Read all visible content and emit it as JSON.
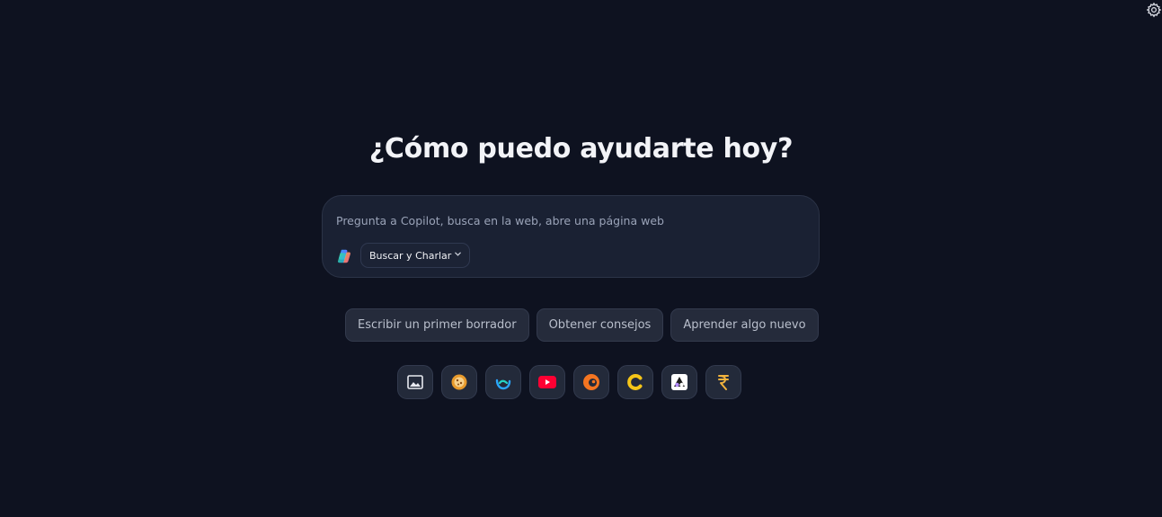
{
  "heading": "¿Cómo puedo ayudarte hoy?",
  "composer": {
    "placeholder": "Pregunta a Copilot, busca en la web, abre una página web",
    "mode_label": "Buscar y Charlar",
    "logo_icon": "copilot-logo-icon",
    "chevron_icon": "chevron-down-icon"
  },
  "suggestions": [
    {
      "label": "Escribir un primer borrador"
    },
    {
      "label": "Obtener consejos"
    },
    {
      "label": "Aprender algo nuevo"
    }
  ],
  "apps": [
    {
      "icon": "image-icon"
    },
    {
      "icon": "cookie-app-icon"
    },
    {
      "icon": "wave-app-icon"
    },
    {
      "icon": "youtube-icon"
    },
    {
      "icon": "crunchyroll-icon"
    },
    {
      "icon": "letter-c-app-icon"
    },
    {
      "icon": "triangle-app-icon"
    },
    {
      "icon": "rupee-app-icon"
    }
  ],
  "settings_icon": "gear-icon",
  "colors": {
    "background": "#0e1220",
    "composer_bg": "#1a2133",
    "chip_bg": "#252b3b",
    "youtube_red": "#ff0033",
    "crunchyroll_orange": "#f47521",
    "yellow_c": "#f5c518"
  }
}
